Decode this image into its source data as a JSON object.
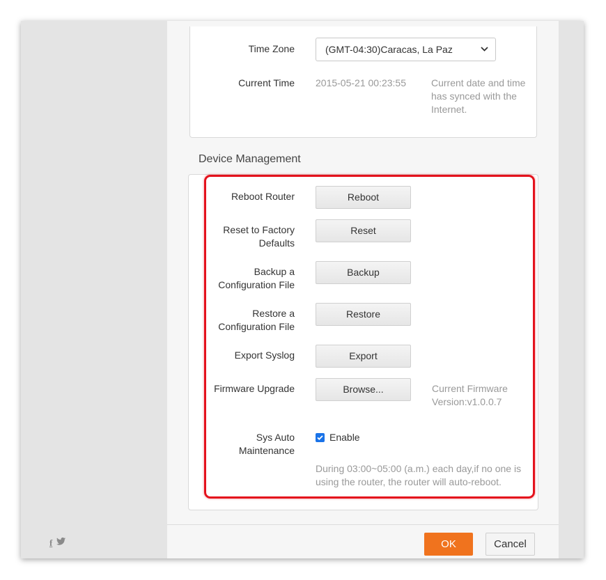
{
  "time_settings": {
    "time_zone_label": "Time Zone",
    "time_zone_value": "(GMT-04:30)Caracas, La Paz",
    "current_time_label": "Current Time",
    "current_time_value": "2015-05-21 00:23:55",
    "sync_note": "Current date and time has synced with the Internet."
  },
  "device_management": {
    "title": "Device Management",
    "reboot_label": "Reboot Router",
    "reboot_button": "Reboot",
    "reset_label": "Reset to Factory Defaults",
    "reset_button": "Reset",
    "backup_label": "Backup a Configuration File",
    "backup_button": "Backup",
    "restore_label": "Restore a Configuration File",
    "restore_button": "Restore",
    "export_label": "Export Syslog",
    "export_button": "Export",
    "firmware_label": "Firmware Upgrade",
    "firmware_button": "Browse...",
    "firmware_version": "Current Firmware Version:v1.0.0.7",
    "auto_maint_label": "Sys Auto Maintenance",
    "auto_maint_checkbox_label": "Enable",
    "auto_maint_checked": true,
    "auto_maint_note": "During 03:00~05:00 (a.m.) each day,if no one is using the router, the router will auto-reboot."
  },
  "footer": {
    "ok": "OK",
    "cancel": "Cancel"
  },
  "icons": {
    "facebook": "facebook-icon",
    "twitter": "twitter-icon",
    "dropdown": "chevron-down-icon",
    "checkbox": "checkbox-checked-icon"
  },
  "colors": {
    "accent": "#f0731e",
    "highlight": "#e4121c",
    "checkbox": "#1a73e8"
  }
}
